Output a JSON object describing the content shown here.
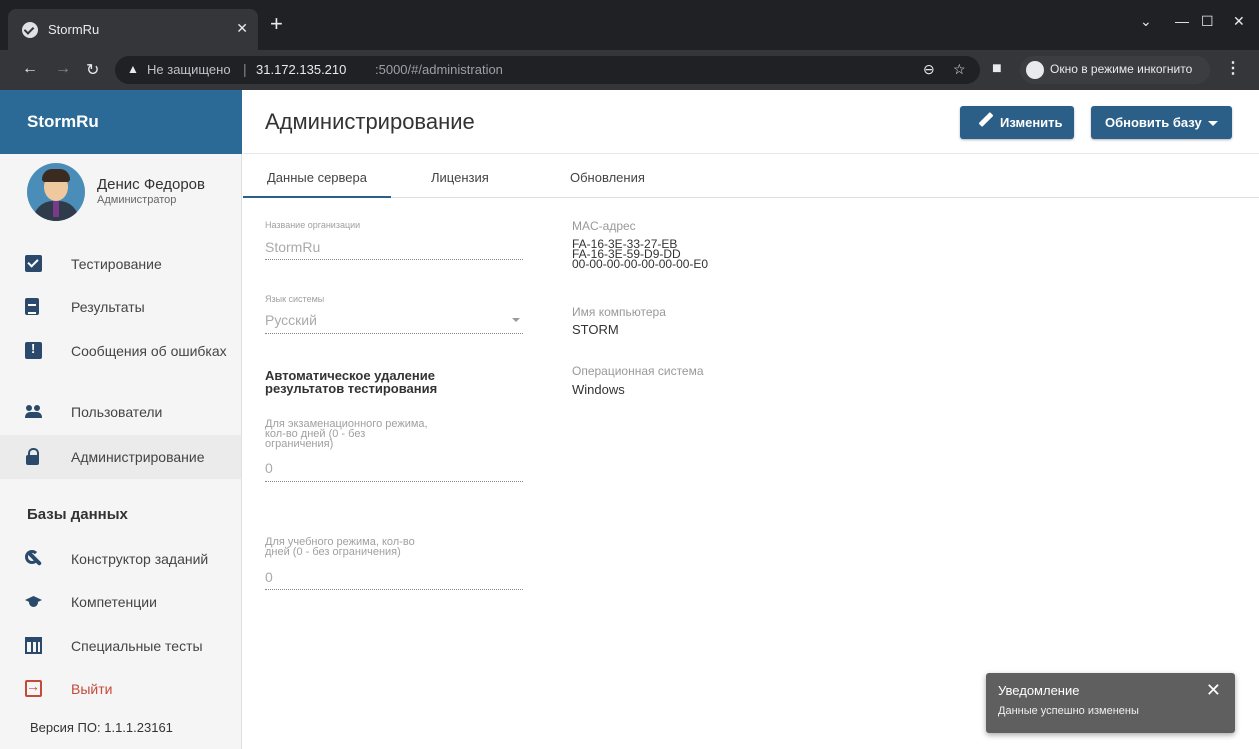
{
  "browser": {
    "tab_title": "StormRu",
    "tab_close": "✕",
    "new_tab": "+",
    "not_secure": "Не защищено",
    "url_host": "31.172.135.210",
    "url_path": ":5000/#/administration",
    "incognito_label": "Окно в режиме инкогнито"
  },
  "sidebar": {
    "brand": "StormRu",
    "user_name": "Денис Федоров",
    "user_role": "Администратор",
    "items": [
      {
        "label": "Тестирование",
        "icon": "checkbox-icon"
      },
      {
        "label": "Результаты",
        "icon": "clipboard-icon"
      },
      {
        "label": "Сообщения об ошибках",
        "icon": "error-message-icon"
      },
      {
        "label": "Пользователи",
        "icon": "users-icon"
      },
      {
        "label": "Администрирование",
        "icon": "lock-icon",
        "active": true
      }
    ],
    "section_title": "Базы данных",
    "db_items": [
      {
        "label": "Конструктор заданий",
        "icon": "wrench-icon"
      },
      {
        "label": "Компетенции",
        "icon": "graduation-cap-icon"
      },
      {
        "label": "Специальные тесты",
        "icon": "table-icon"
      }
    ],
    "logout": "Выйти",
    "version": "Версия ПО: 1.1.1.23161"
  },
  "header": {
    "title": "Администрирование",
    "edit_button": "Изменить",
    "update_button": "Обновить базу"
  },
  "tabs": [
    {
      "label": "Данные сервера",
      "active": true
    },
    {
      "label": "Лицензия"
    },
    {
      "label": "Обновления"
    }
  ],
  "form": {
    "org_label": "Название организации",
    "org_value": "StormRu",
    "lang_label": "Язык системы",
    "lang_value": "Русский",
    "auto_title_1": "Автоматическое удаление",
    "auto_title_2": "результатов тестирования",
    "exam_label_1": "Для экзаменационного режима,",
    "exam_label_2": "кол-во дней (0 - без",
    "exam_label_3": "ограничения)",
    "exam_value": "0",
    "study_label_1": "Для учебного режима, кол-во",
    "study_label_2": "дней (0 - без ограничения)",
    "study_value": "0"
  },
  "server": {
    "mac_label": "MAC-адрес",
    "mac_values": [
      "FA-16-3E-33-27-EB",
      "FA-16-3E-59-D9-DD",
      "00-00-00-00-00-00-00-E0"
    ],
    "pc_label": "Имя компьютера",
    "pc_value": "STORM",
    "os_label": "Операционная система",
    "os_value": "Windows"
  },
  "toast": {
    "title": "Уведомление",
    "message": "Данные успешно изменены"
  },
  "colors": {
    "brand": "#2b6a96",
    "button": "#2b5f88",
    "toast": "#5f5f5f",
    "logout": "#c44a3a"
  }
}
